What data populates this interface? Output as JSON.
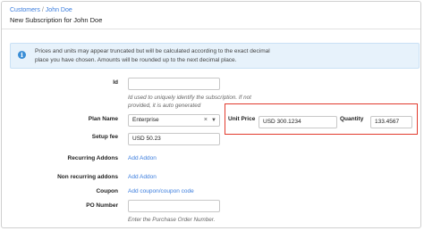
{
  "breadcrumb": {
    "parent": "Customers",
    "separator": "/",
    "current": "John Doe"
  },
  "page_title": "New Subscription for John Doe",
  "alert": {
    "icon": "info-icon",
    "message": "Prices and units may appear truncated but will be calculated according to the exact decimal place you have chosen. Amounts will be rounded up to the next decimal place."
  },
  "form": {
    "id": {
      "label": "Id",
      "value": "",
      "hint": "Id used to uniquely identify the subscription. If not provided, it is auto generated"
    },
    "plan_name": {
      "label": "Plan Name",
      "value": "Enterprise",
      "clear": "×",
      "caret": "▼"
    },
    "unit_price": {
      "label": "Unit Price",
      "value": "USD  300.1234"
    },
    "quantity": {
      "label": "Quantity",
      "value": "133.4567"
    },
    "setup_fee": {
      "label": "Setup fee",
      "value": "USD  50.23"
    },
    "recurring_addons": {
      "label": "Recurring Addons",
      "link": "Add Addon"
    },
    "non_recurring_addons": {
      "label": "Non recurring addons",
      "link": "Add Addon"
    },
    "coupon": {
      "label": "Coupon",
      "link": "Add coupon/coupon code"
    },
    "po_number": {
      "label": "PO Number",
      "value": "",
      "hint": "Enter the Purchase Order Number."
    }
  },
  "colors": {
    "link": "#3b7ddd",
    "alert_bg": "#e7f2fb",
    "highlight": "#e23b2e"
  }
}
